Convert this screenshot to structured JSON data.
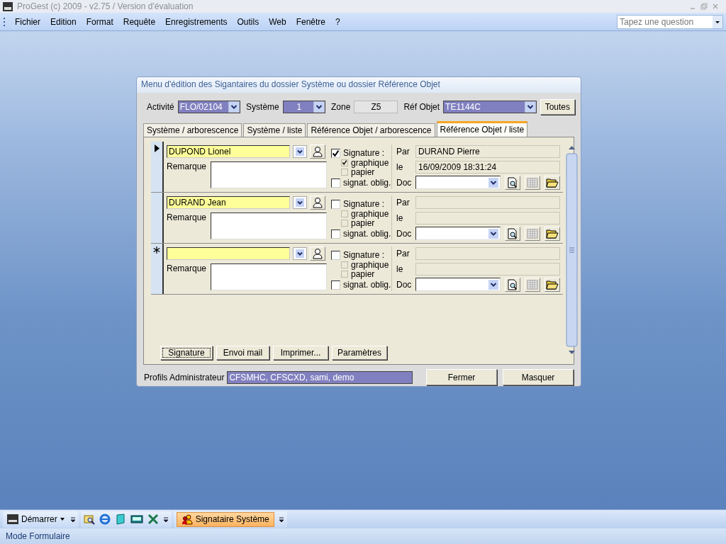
{
  "window": {
    "title": "ProGest (c) 2009 - v2.75 / Version d'évaluation"
  },
  "menu": [
    {
      "label": "Fichier"
    },
    {
      "label": "Edition"
    },
    {
      "label": "Format"
    },
    {
      "label": "Requête"
    },
    {
      "label": "Enregistrements"
    },
    {
      "label": "Outils"
    },
    {
      "label": "Web"
    },
    {
      "label": "Fenêtre"
    },
    {
      "label": "?"
    }
  ],
  "help_search": {
    "placeholder": "Tapez une question"
  },
  "dialog": {
    "title": "Menu d'édition des Sigantaires du dossier Système ou dossier Référence Objet",
    "filters": [
      {
        "label": "Activité",
        "value": "FLO/02104",
        "kind": "combo"
      },
      {
        "label": "Système",
        "value": "1",
        "kind": "combo"
      },
      {
        "label": "Zone",
        "value": "Z5",
        "kind": "readonly"
      },
      {
        "label": "Réf Objet",
        "value": "TE1144C",
        "kind": "combo"
      }
    ],
    "all_button": "Toutes",
    "tabs": [
      {
        "label": "Système / arborescence",
        "selected": false
      },
      {
        "label": "Système / liste",
        "selected": false
      },
      {
        "label": "Référence Objet / arborescence",
        "selected": false
      },
      {
        "label": "Référence Objet / liste",
        "selected": true
      }
    ],
    "records": [
      {
        "kind": "current",
        "name": "DUPOND Lionel",
        "remark_label": "Remarque",
        "signature_label": "Signature :",
        "signature": true,
        "graphic_label": "graphique",
        "graphic": true,
        "paper_label": "papier",
        "paper": false,
        "mandatory_label": "signat. oblig.",
        "mandatory": false,
        "by_label": "Par",
        "by": "DURAND Pierre",
        "date_label": "le",
        "date": "16/09/2009 18:31:24",
        "doc_label": "Doc"
      },
      {
        "kind": "normal",
        "name": "DURAND Jean",
        "remark_label": "Remarque",
        "signature_label": "Signature :",
        "signature": false,
        "graphic_label": "graphique",
        "graphic": false,
        "paper_label": "papier",
        "paper": false,
        "mandatory_label": "signat. oblig.",
        "mandatory": false,
        "by_label": "Par",
        "date_label": "le",
        "doc_label": "Doc"
      },
      {
        "kind": "new",
        "remark_label": "Remarque",
        "signature_label": "Signature :",
        "signature": false,
        "graphic_label": "graphique",
        "graphic": false,
        "paper_label": "papier",
        "paper": false,
        "mandatory_label": "signat. oblig.",
        "mandatory": false,
        "by_label": "Par",
        "date_label": "le",
        "doc_label": "Doc"
      }
    ],
    "actions": [
      {
        "label": "Signature",
        "focused": true
      },
      {
        "label": "Envoi mail",
        "focused": false
      },
      {
        "label": "Imprimer...",
        "focused": false
      },
      {
        "label": "Paramètres",
        "focused": false
      }
    ],
    "admin_profiles": {
      "label": "Profils Administrateur",
      "value": "CFSMHC, CFSCXD, sami, demo"
    },
    "footer_buttons": [
      {
        "label": "Fermer"
      },
      {
        "label": "Masquer"
      }
    ]
  },
  "taskbar": {
    "start": "Démarrer",
    "active_task": "Signataire Système"
  },
  "status_bar": "Mode Formulaire"
}
